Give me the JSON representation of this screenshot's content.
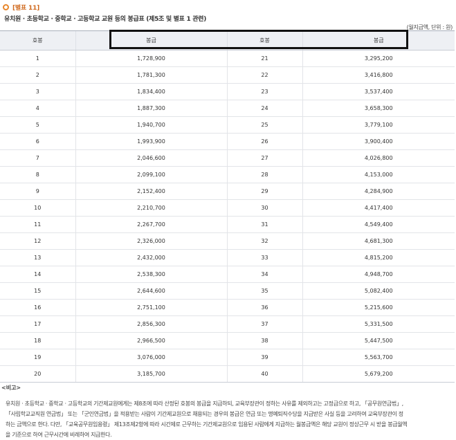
{
  "header": {
    "title": "[별표 11]",
    "subtitle": "유치원 · 초등학교 · 중학교 · 고등학교 교원 등의 봉급표 (제5조 및 별표 1 관련)",
    "unit": "(월지급액, 단위 : 원)"
  },
  "table": {
    "headers": [
      "호봉",
      "봉급",
      "호봉",
      "봉급"
    ],
    "rows": [
      [
        "1",
        "1,728,900",
        "21",
        "3,295,200"
      ],
      [
        "2",
        "1,781,300",
        "22",
        "3,416,800"
      ],
      [
        "3",
        "1,834,400",
        "23",
        "3,537,400"
      ],
      [
        "4",
        "1,887,300",
        "24",
        "3,658,300"
      ],
      [
        "5",
        "1,940,700",
        "25",
        "3,779,100"
      ],
      [
        "6",
        "1,993,900",
        "26",
        "3,900,400"
      ],
      [
        "7",
        "2,046,600",
        "27",
        "4,026,800"
      ],
      [
        "8",
        "2,099,100",
        "28",
        "4,153,000"
      ],
      [
        "9",
        "2,152,400",
        "29",
        "4,284,900"
      ],
      [
        "10",
        "2,210,700",
        "30",
        "4,417,400"
      ],
      [
        "11",
        "2,267,700",
        "31",
        "4,549,400"
      ],
      [
        "12",
        "2,326,000",
        "32",
        "4,681,300"
      ],
      [
        "13",
        "2,432,000",
        "33",
        "4,815,200"
      ],
      [
        "14",
        "2,538,300",
        "34",
        "4,948,700"
      ],
      [
        "15",
        "2,644,600",
        "35",
        "5,082,400"
      ],
      [
        "16",
        "2,751,100",
        "36",
        "5,215,600"
      ],
      [
        "17",
        "2,856,300",
        "37",
        "5,331,500"
      ],
      [
        "18",
        "2,966,500",
        "38",
        "5,447,500"
      ],
      [
        "19",
        "3,076,000",
        "39",
        "5,563,700"
      ],
      [
        "20",
        "3,185,700",
        "40",
        "5,679,200"
      ]
    ]
  },
  "notes": {
    "heading": "<비고>",
    "lines": [
      "유치원 · 초등학교 · 중학교 · 고등학교의 기간제교원에게는 제8조에 따라 산정된 호봉의 봉급을 지급하되, 교육부장관이 정하는 사유를 제외하고는 고정급으로 하고, 「공무원연금법」,",
      "「사립학교교직원 연금법」 또는 「군인연금법」을 적용받는 사람이 기간제교원으로 채용되는 경우의 봉급은 연금 또는 명예퇴직수당을 지급받은 사실 등을 고려하여 교육부장관이 정",
      "하는 금액으로 한다. 다만, 「교육공무원임용령」 제13조제2항에 따라 시간제로 근무하는 기간제교원으로 임용된 사람에게 지급하는 월봉급액은 해당 교원이 정상근무 시 받을 봉급월액",
      "을 기준으로 하여 근무시간에 비례하여 지급한다."
    ]
  },
  "colors": {
    "title": "#d06a1f",
    "bullet": "#e8862a",
    "header_bg": "#eef0f4",
    "highlight_border": "#111111"
  }
}
